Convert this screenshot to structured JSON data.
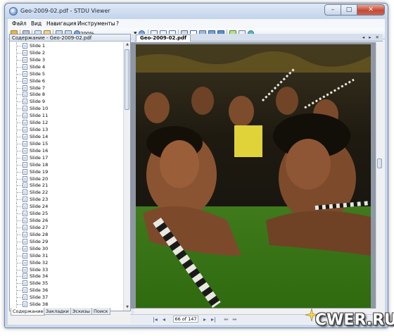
{
  "window": {
    "title": "Geo-2009-02.pdf - STDU Viewer",
    "minimize": "–",
    "maximize": "□",
    "close": "✕"
  },
  "menu": {
    "file": "Файл",
    "view": "Вид",
    "navigation": "Навигация",
    "tools": "Инструменты",
    "help": "?"
  },
  "toolbar": {
    "zoom": "200%",
    "icons": [
      "open-icon",
      "print-icon",
      "save-icon",
      "export-icon",
      "copy-icon",
      "paste-icon",
      "zoom-out-icon",
      "zoom-in-icon",
      "single-page-icon",
      "two-page-icon",
      "continuous-icon",
      "find-icon",
      "select-text-icon",
      "snapshot-icon",
      "hand-icon",
      "rotate-icon",
      "page-layout-icon",
      "refresh-icon"
    ]
  },
  "left_panel": {
    "header": "Содержание - Geo-2009-02.pdf",
    "items": [
      "Slide 1",
      "Slide 2",
      "Slide 3",
      "Slide 4",
      "Slide 5",
      "Slide 6",
      "Slide 7",
      "Slide 8",
      "Slide 9",
      "Slide 10",
      "Slide 11",
      "Slide 12",
      "Slide 13",
      "Slide 14",
      "Slide 15",
      "Slide 16",
      "Slide 17",
      "Slide 18",
      "Slide 19",
      "Slide 20",
      "Slide 21",
      "Slide 22",
      "Slide 23",
      "Slide 24",
      "Slide 25",
      "Slide 26",
      "Slide 27",
      "Slide 28",
      "Slide 29",
      "Slide 30",
      "Slide 31",
      "Slide 32",
      "Slide 33",
      "Slide 34",
      "Slide 35",
      "Slide 36",
      "Slide 37",
      "Slide 38"
    ],
    "tabs": [
      "Содержание",
      "Закладки",
      "Эскизы",
      "Поиск"
    ]
  },
  "document": {
    "tab": "Geo-2009-02.pdf",
    "tab_nav": "◂ ▸ ✕"
  },
  "status": {
    "first": "|◂",
    "prev": "◂",
    "page": "66 of 147",
    "next": "▸",
    "last": "▸|",
    "back": "⬅",
    "forward": "➡"
  },
  "watermark": {
    "text": "CWER.RU"
  }
}
